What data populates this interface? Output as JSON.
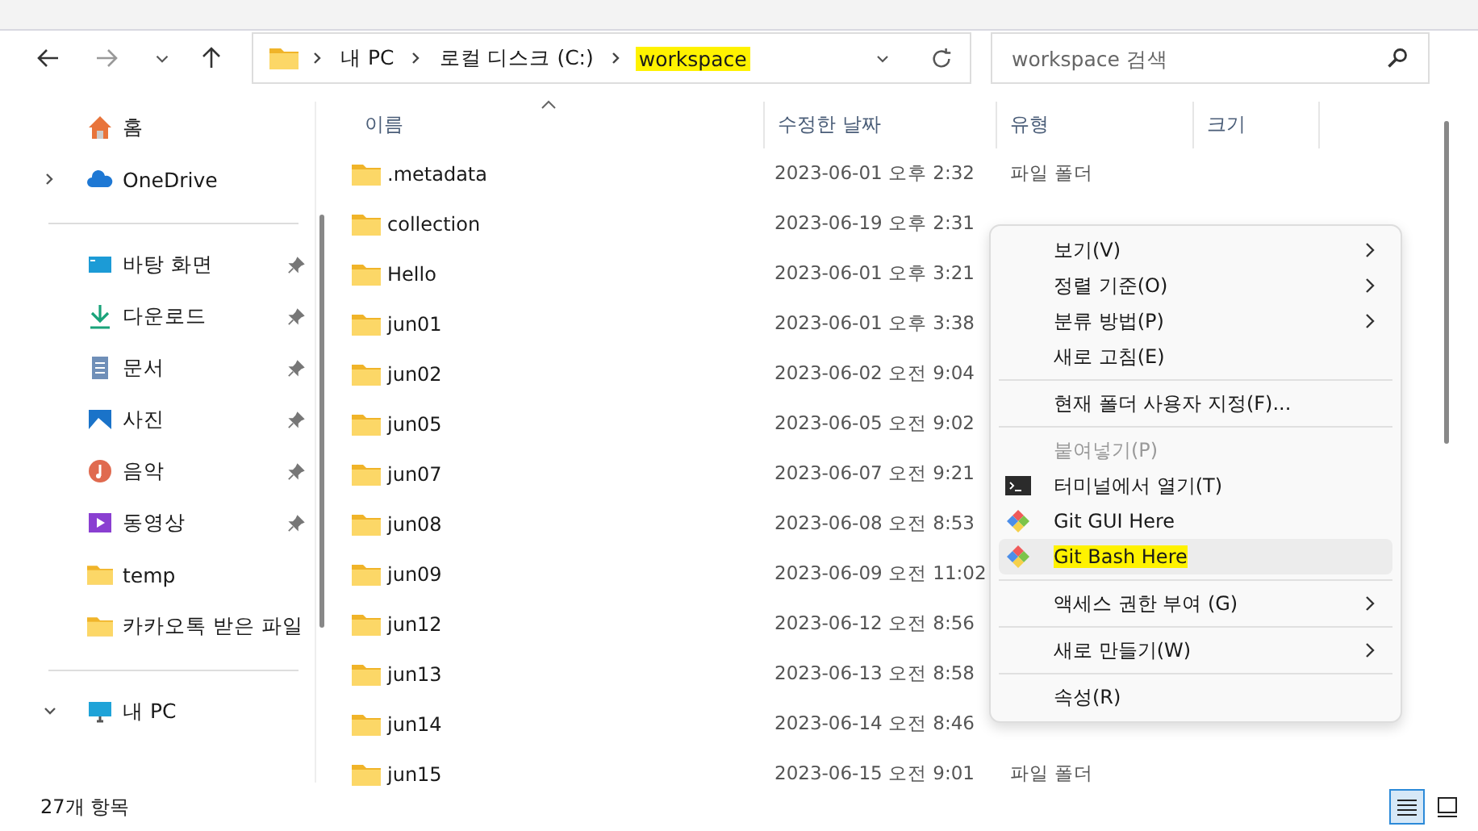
{
  "address_bar": {
    "crumbs": [
      {
        "label": "내 PC",
        "highlighted": false
      },
      {
        "label": "로컬 디스크 (C:)",
        "highlighted": false
      },
      {
        "label": "workspace",
        "highlighted": true
      }
    ]
  },
  "search": {
    "placeholder": "workspace 검색"
  },
  "sidebar": {
    "groups": [
      [
        {
          "label": "홈",
          "kind": "home"
        },
        {
          "label": "OneDrive",
          "kind": "cloud",
          "expanded": false
        }
      ],
      [
        {
          "label": "바탕 화면",
          "kind": "desktop",
          "pinned": true
        },
        {
          "label": "다운로드",
          "kind": "download",
          "pinned": true
        },
        {
          "label": "문서",
          "kind": "document",
          "pinned": true
        },
        {
          "label": "사진",
          "kind": "picture",
          "pinned": true
        },
        {
          "label": "음악",
          "kind": "music",
          "pinned": true
        },
        {
          "label": "동영상",
          "kind": "video",
          "pinned": true
        },
        {
          "label": "temp",
          "kind": "folder",
          "pinned": false
        },
        {
          "label": "카카오톡 받은 파일",
          "kind": "folder",
          "pinned": false
        }
      ],
      [
        {
          "label": "내 PC",
          "kind": "pc",
          "expanded": true
        }
      ]
    ]
  },
  "table": {
    "columns": [
      {
        "label": "이름",
        "sorted": true
      },
      {
        "label": "수정한 날짜",
        "sorted": false
      },
      {
        "label": "유형",
        "sorted": false
      },
      {
        "label": "크기",
        "sorted": false
      }
    ],
    "rows": [
      {
        "name": ".metadata",
        "date": "2023-06-01 오후 2:32",
        "type": "파일 폴더"
      },
      {
        "name": "collection",
        "date": "2023-06-19 오후 2:31"
      },
      {
        "name": "Hello",
        "date": "2023-06-01 오후 3:21"
      },
      {
        "name": "jun01",
        "date": "2023-06-01 오후 3:38"
      },
      {
        "name": "jun02",
        "date": "2023-06-02 오전 9:04"
      },
      {
        "name": "jun05",
        "date": "2023-06-05 오전 9:02"
      },
      {
        "name": "jun07",
        "date": "2023-06-07 오전 9:21"
      },
      {
        "name": "jun08",
        "date": "2023-06-08 오전 8:53"
      },
      {
        "name": "jun09",
        "date": "2023-06-09 오전 11:02"
      },
      {
        "name": "jun12",
        "date": "2023-06-12 오전 8:56"
      },
      {
        "name": "jun13",
        "date": "2023-06-13 오전 8:58"
      },
      {
        "name": "jun14",
        "date": "2023-06-14 오전 8:46"
      },
      {
        "name": "jun15",
        "date": "2023-06-15 오전 9:01",
        "type": "파일 폴더"
      }
    ]
  },
  "context_menu": {
    "items": [
      {
        "kind": "item",
        "label": "보기(V)",
        "submenu": true,
        "disabled": false,
        "selected": false,
        "highlighted": false
      },
      {
        "kind": "item",
        "label": "정렬 기준(O)",
        "submenu": true,
        "disabled": false,
        "selected": false,
        "highlighted": false
      },
      {
        "kind": "item",
        "label": "분류 방법(P)",
        "submenu": true,
        "disabled": false,
        "selected": false,
        "highlighted": false
      },
      {
        "kind": "item",
        "label": "새로 고침(E)",
        "submenu": false,
        "disabled": false,
        "selected": false,
        "highlighted": false
      },
      {
        "kind": "separator"
      },
      {
        "kind": "item",
        "label": "현재 폴더 사용자 지정(F)...",
        "submenu": false,
        "disabled": false,
        "selected": false,
        "highlighted": false
      },
      {
        "kind": "separator"
      },
      {
        "kind": "item",
        "label": "붙여넣기(P)",
        "submenu": false,
        "disabled": true,
        "selected": false,
        "highlighted": false
      },
      {
        "kind": "terminal_item",
        "label": "터미널에서 열기(T)",
        "submenu": false,
        "disabled": false,
        "selected": false,
        "highlighted": false
      },
      {
        "kind": "git_item",
        "label": "Git GUI Here",
        "submenu": false,
        "disabled": false,
        "selected": false,
        "highlighted": false
      },
      {
        "kind": "git_item",
        "label": "Git Bash Here",
        "submenu": false,
        "disabled": false,
        "selected": true,
        "highlighted": true
      },
      {
        "kind": "separator"
      },
      {
        "kind": "item",
        "label": "액세스 권한 부여 (G)",
        "submenu": true,
        "disabled": false,
        "selected": false,
        "highlighted": false
      },
      {
        "kind": "separator"
      },
      {
        "kind": "item",
        "label": "새로 만들기(W)",
        "submenu": true,
        "disabled": false,
        "selected": false,
        "highlighted": false
      },
      {
        "kind": "separator"
      },
      {
        "kind": "item",
        "label": "속성(R)",
        "submenu": false,
        "disabled": false,
        "selected": false,
        "highlighted": false
      }
    ]
  },
  "status_bar": {
    "count": "27개 항목"
  },
  "view_buttons": [
    {
      "kind": "details",
      "selected": true
    },
    {
      "kind": "tiles",
      "selected": false
    }
  ]
}
